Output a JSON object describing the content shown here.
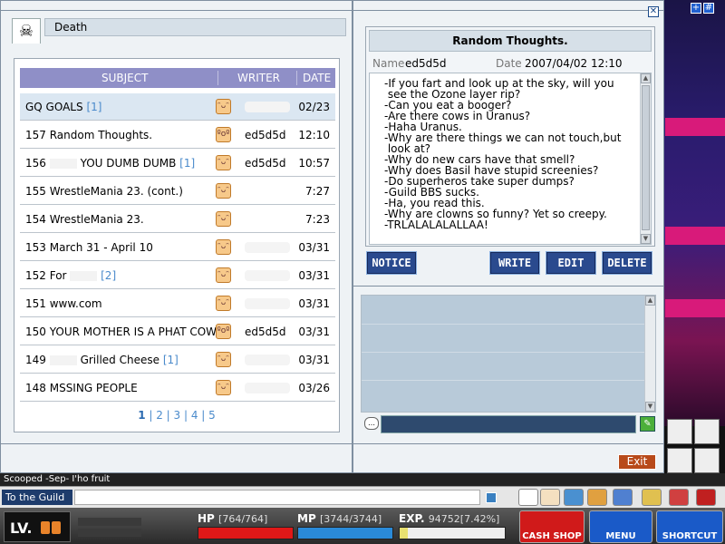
{
  "guild": {
    "name": "Death"
  },
  "board": {
    "columns": {
      "subject": "SUBJECT",
      "writer": "WRITER",
      "date": "DATE"
    },
    "rows": [
      {
        "subject": "GQ GOALS",
        "count": "[1]",
        "writer": "",
        "date": "02/23"
      },
      {
        "subject": "157 Random Thoughts.",
        "count": "",
        "writer": "ed5d5d",
        "date": "12:10"
      },
      {
        "subject": "156",
        "subject_tail": "YOU DUMB DUMB",
        "count": "[1]",
        "writer": "ed5d5d",
        "date": "10:57"
      },
      {
        "subject": "155 WrestleMania 23. (cont.)",
        "count": "",
        "writer": "",
        "date": "7:27"
      },
      {
        "subject": "154 WrestleMania 23.",
        "count": "",
        "writer": "",
        "date": "7:23"
      },
      {
        "subject": "153 March 31 - April 10",
        "count": "",
        "writer": "",
        "date": "03/31"
      },
      {
        "subject": "152 For",
        "count": "[2]",
        "writer": "",
        "date": "03/31"
      },
      {
        "subject": "151 www.com",
        "count": "",
        "writer": "",
        "date": "03/31"
      },
      {
        "subject": "150 YOUR MOTHER IS A PHAT COW",
        "count": "[",
        "writer": "ed5d5d",
        "date": "03/31"
      },
      {
        "subject": "149",
        "subject_tail": "Grilled Cheese",
        "count": "[1]",
        "writer": "",
        "date": "03/31"
      },
      {
        "subject": "148 MSSING PEOPLE",
        "count": "",
        "writer": "",
        "date": "03/26"
      }
    ],
    "pages": {
      "current": "1",
      "others": [
        "2",
        "3",
        "4",
        "5"
      ]
    }
  },
  "post": {
    "title": "Random Thoughts.",
    "name_label": "Name",
    "name_value": "ed5d5d",
    "date_label": "Date",
    "date_value": "2007/04/02 12:10",
    "body": "-If you fart and look up at the sky, will you\n see the Ozone layer rip?\n-Can you eat a booger?\n-Are there cows in Uranus?\n-Haha Uranus.\n-Why are there things we can not touch,but\n look at?\n-Why do new cars have that smell?\n-Why does Basil have stupid screenies?\n-Do superheros take super dumps?\n-Guild BBS sucks.\n-Ha, you read this.\n-Why are clowns so funny? Yet so creepy.\n-TRLALALALALLAA!"
  },
  "buttons": {
    "notice": "NOTICE",
    "write": "WRITE",
    "edit": "EDIT",
    "delete": "DELETE",
    "exit": "Exit"
  },
  "chat": {
    "partial_line": "Scooped -Sep- I'ho fruit",
    "target": "To the Guild"
  },
  "status": {
    "level_label": "LV.",
    "hp_label": "HP",
    "hp_value": "[764/764]",
    "hp_fraction": 1.0,
    "mp_label": "MP",
    "mp_value": "[3744/3744]",
    "mp_fraction": 1.0,
    "exp_label": "EXP.",
    "exp_value": "94752[7.42%]",
    "exp_fraction": 0.0742
  },
  "menu_buttons": {
    "cash_shop": "CASH SHOP",
    "menu": "MENU",
    "shortcut": "SHORTCUT"
  },
  "colors": {
    "hp": "#e01818",
    "mp": "#2a8ad8",
    "exp": "#e8e070",
    "header": "#8f8fc7",
    "link": "#4a8acb"
  }
}
